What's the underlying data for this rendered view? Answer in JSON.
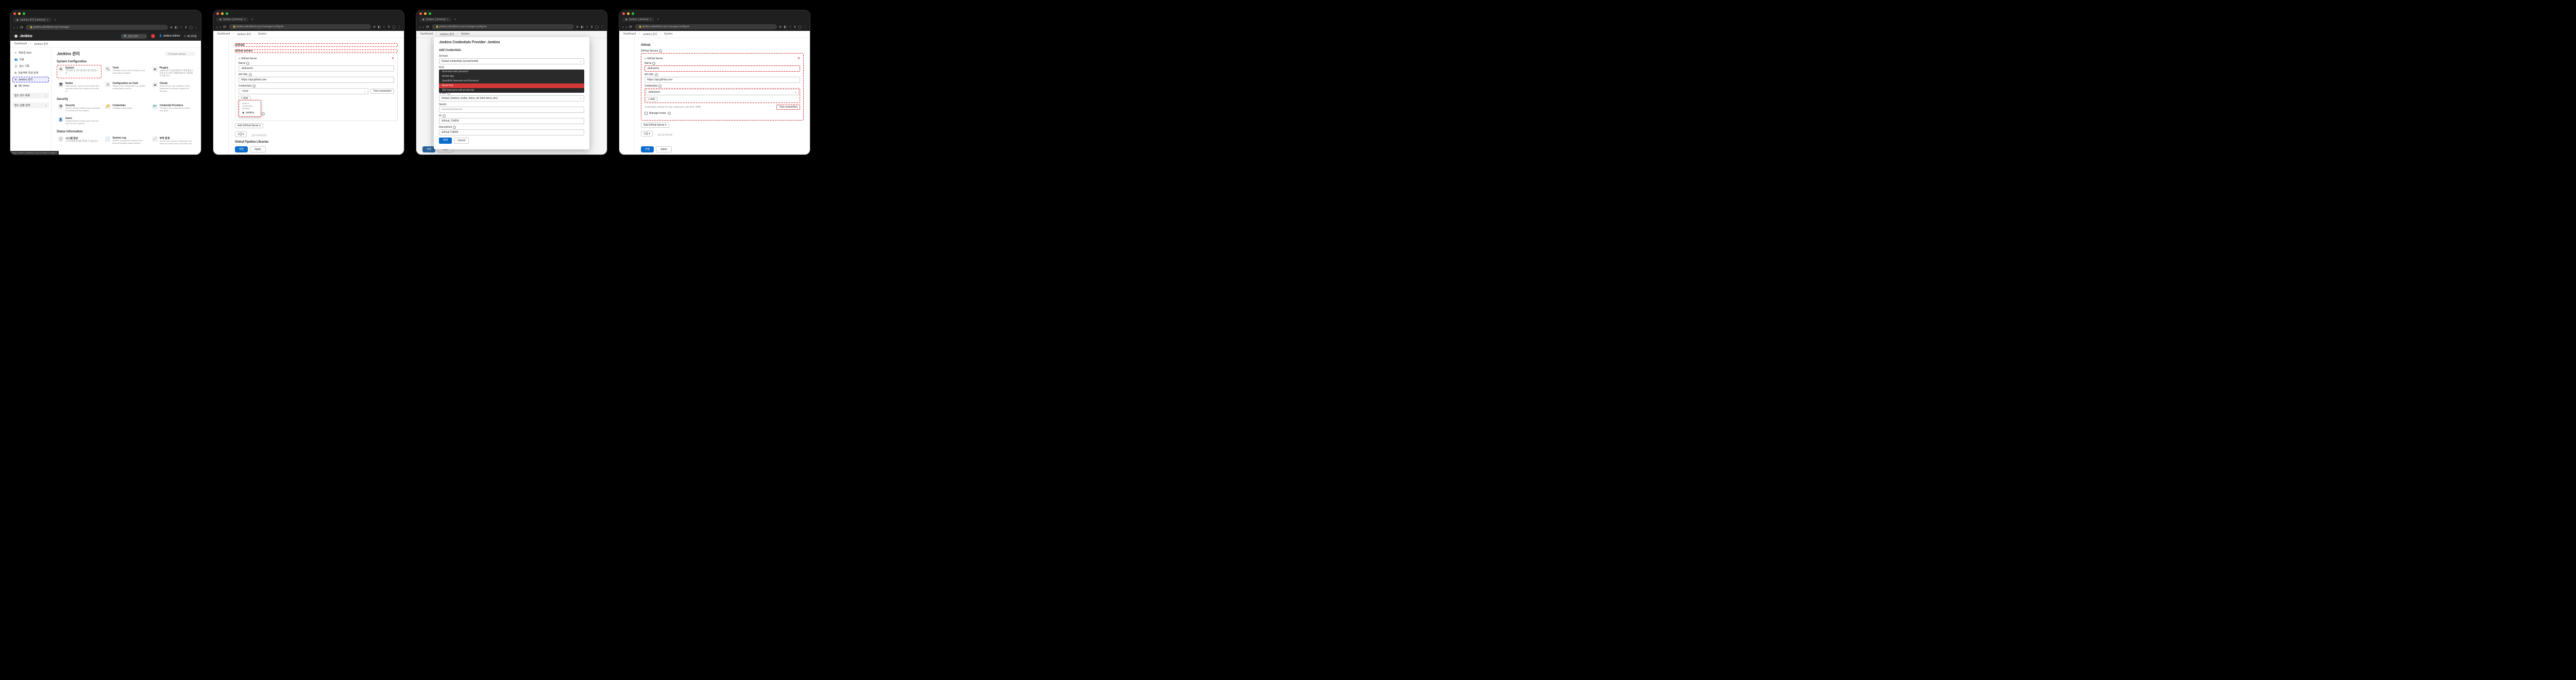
{
  "browser": {
    "tab_title_s1": "Jenkins 관리 [Jenkins]",
    "tab_title_sys": "System [Jenkins]",
    "url_s1": "jenkins.aknitberts.xyz/manage/",
    "url_sys": "jenkins.aknitberts.xyz/manage/configure"
  },
  "jenkins": {
    "brand": "Jenkins",
    "search_placeholder": "검색 (#K)",
    "user": "Jenkins Admin",
    "logout": "로그아웃",
    "notif_count": "2"
  },
  "crumbs": {
    "dashboard": "Dashboard",
    "manage": "Jenkins 관리",
    "system": "System"
  },
  "s1": {
    "title": "Jenkins 관리",
    "search": "Search settings",
    "side": {
      "new_item": "새로운 Item",
      "people": "사람",
      "history": "빌드 기록",
      "project": "프로젝트 연관 관계",
      "manage": "Jenkins 관리",
      "my_views": "My Views",
      "queue": "빌드 대기 목록",
      "executor": "빌드 실행 상태"
    },
    "sect1": "System Configuration",
    "cards1": [
      {
        "t": "System",
        "d": "전역설정 및 경로 환경변수를 설정합니다."
      },
      {
        "t": "Tools",
        "d": "Configure tools, their locations, and automatic installers."
      },
      {
        "t": "Plugins",
        "d": "Jenkins의 기능을 확장하기 위해 플러그인을 추가, 제거, 비활성화하거나 설정할 수 있습니다."
      },
      {
        "t": "Nodes",
        "d": "Add, remove, control and monitor the various nodes that Jenkins runs jobs on."
      },
      {
        "t": "Configuration as Code",
        "d": "Reload your configuration or update configuration source."
      },
      {
        "t": "Clouds",
        "d": "Add, remove, and configure cloud instances to provision agents on-demand."
      }
    ],
    "sect2": "Security",
    "cards2": [
      {
        "t": "Security",
        "d": "Secure Jenkins; define who is allowed to access/use the system."
      },
      {
        "t": "Credentials",
        "d": "Configure credentials"
      },
      {
        "t": "Credential Providers",
        "d": "Configure the credential providers and types"
      },
      {
        "t": "Users",
        "d": "Create/delete/modify users that can log in to this Jenkins."
      }
    ],
    "sect3": "Status Information",
    "cards3": [
      {
        "t": "시스템 정보",
        "d": "시스템 환경정보를 확인할 수 있습니다."
      },
      {
        "t": "System Log",
        "d": "System log captures output from java.util.logging output related..."
      },
      {
        "t": "부하 통계",
        "d": "Check your resource utilization and see if you need more computers for..."
      }
    ],
    "status_url": "https://jenkins.aknitberts.xyz/manage/configure"
  },
  "cfg": {
    "github_h": "GitHub",
    "servers_h": "GitHub Servers",
    "server_row": "GitHub Server",
    "name_lbl": "Name",
    "name_val": "Jenkiverts",
    "api_lbl": "API URL",
    "api_val": "https://api.github.com",
    "cred_lbl": "Credentials",
    "cred_none": "- none -",
    "cred_val": "Jenkiverts",
    "cred_tip": "Credentials verified for user Jenkiverts, rate limit: 4998",
    "add_btn": "+ Add",
    "jenkins_provider": "Jenkins Credentials Provider",
    "jenkins_item": "Jenkins",
    "hooks": "Manage hooks",
    "add_server": "Add GitHub Server",
    "advanced": "고급",
    "test_btn": "Test connection",
    "hidden_value": "- 값이 숨겨져 있음 -",
    "pipeline_h": "Global Pipeline Libraries",
    "save": "저장",
    "apply": "Apply"
  },
  "modal": {
    "title": "Jenkins Credentials Provider: Jenkins",
    "add_h": "Add Credentials",
    "domain_lbl": "Domain",
    "domain_val": "Global credentials (unrestricted)",
    "kind_lbl": "Kind",
    "kind_opts": [
      "Username with password",
      "GitHub App",
      "OpenShift Username and Password",
      "Secret text",
      "SSH Username with private key"
    ],
    "scope_lbl": "Scope",
    "scope_val": "Global (Jenkins, nodes, items, all child items, etc)",
    "secret_lbl": "Secret",
    "secret_val": "••••••••••••••••••••••••",
    "id_lbl": "ID",
    "id_val": "GitHub_TOKEN",
    "desc_lbl": "Description",
    "desc_val": "GitHub TOKEN",
    "add": "Add",
    "cancel": "Cancel"
  }
}
